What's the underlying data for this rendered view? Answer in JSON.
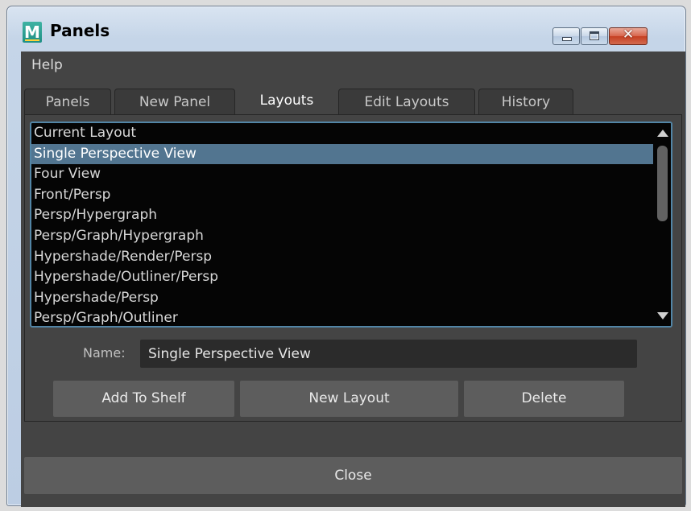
{
  "window": {
    "icon_letter": "M",
    "title": "Panels",
    "controls": {
      "minimize": "minimize-icon",
      "maximize": "maximize-icon",
      "close": "close-icon",
      "close_glyph": "✕"
    }
  },
  "menubar": {
    "items": [
      "Help"
    ]
  },
  "tabs": [
    {
      "label": "Panels",
      "active": false
    },
    {
      "label": "New Panel",
      "active": false
    },
    {
      "label": "Layouts",
      "active": true
    },
    {
      "label": "Edit Layouts",
      "active": false
    },
    {
      "label": "History",
      "active": false
    }
  ],
  "layouts": {
    "items": [
      "Current Layout",
      "Single Perspective View",
      "Four View",
      "Front/Persp",
      "Persp/Hypergraph",
      "Persp/Graph/Hypergraph",
      "Hypershade/Render/Persp",
      "Hypershade/Outliner/Persp",
      "Hypershade/Persp",
      "Persp/Graph/Outliner"
    ],
    "selected_index": 1
  },
  "name_field": {
    "label": "Name:",
    "value": "Single Perspective View"
  },
  "buttons": {
    "add_to_shelf": "Add To Shelf",
    "new_layout": "New Layout",
    "delete": "Delete"
  },
  "footer": {
    "close": "Close"
  },
  "colors": {
    "selection": "#527590",
    "list_border": "#5285a6",
    "client_bg": "#444444",
    "button_bg": "#5d5d5d"
  }
}
